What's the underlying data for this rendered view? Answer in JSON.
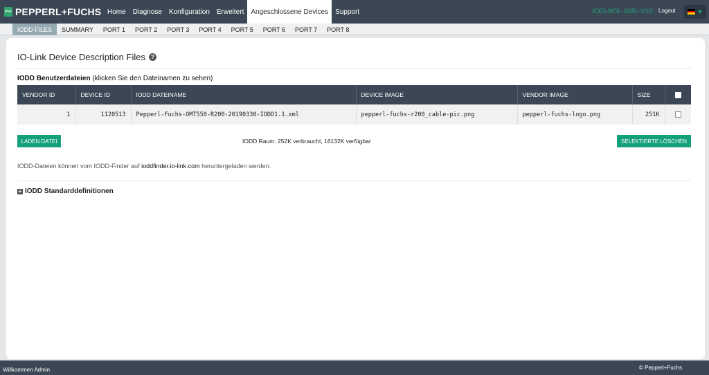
{
  "brand": {
    "mark": "P+F",
    "name": "PEPPERL+FUCHS"
  },
  "nav": {
    "items": [
      {
        "label": "Home"
      },
      {
        "label": "Diagnose"
      },
      {
        "label": "Konfiguration"
      },
      {
        "label": "Erweitert"
      },
      {
        "label": "Angeschlossene Devices"
      },
      {
        "label": "Support"
      }
    ],
    "active_index": 4
  },
  "header": {
    "device_name": "ICE3-8IOL-G65L-V1D",
    "logout_label": "Logout",
    "language_flag_icon": "german-flag-icon"
  },
  "subnav": {
    "items": [
      {
        "label": "IODD FILES"
      },
      {
        "label": "SUMMARY"
      },
      {
        "label": "PORT 1"
      },
      {
        "label": "PORT 2"
      },
      {
        "label": "PORT 3"
      },
      {
        "label": "PORT 4"
      },
      {
        "label": "PORT 5"
      },
      {
        "label": "PORT 6"
      },
      {
        "label": "PORT 7"
      },
      {
        "label": "PORT 8"
      }
    ],
    "active_index": 0
  },
  "page": {
    "title": "IO-Link Device Description Files",
    "help_icon": "question-circle-icon",
    "section_bold": "IODD Benutzerdateien",
    "section_note": " (klicken Sie den Dateinamen zu sehen)"
  },
  "table": {
    "headers": [
      "VENDOR ID",
      "DEVICE ID",
      "IODD DATEINAME",
      "DEVICE IMAGE",
      "VENDOR IMAGE",
      "SIZE"
    ],
    "rows": [
      {
        "vendor_id": "1",
        "device_id": "1120513",
        "filename": "Pepperl-Fuchs-OMT550-R200-20190330-IODD1.1.xml",
        "device_image": "pepperl-fuchs-r200_cable-pic.png",
        "vendor_image": "pepperl-fuchs-logo.png",
        "size": "251K"
      }
    ]
  },
  "actions": {
    "load_label": "LADEN DATEI",
    "space_info": "IODD Raum: 252K verbraucht, 16132K verfügbar",
    "delete_label": "SELEKTIERTE LÖSCHEN"
  },
  "note": {
    "before": "IODD-Dateien können vom IODD-Finder auf ",
    "link": "ioddfinder.io-link.com",
    "after": " heruntergeladen werden."
  },
  "standard_defs": {
    "label": "IODD Standarddefinitionen",
    "icon": "plus-box-icon"
  },
  "footer": {
    "welcome": "Willkommen Admin",
    "copyright": "© Pepperl+Fuchs"
  },
  "colors": {
    "header_bg": "#3b4754",
    "accent_green": "#14a07a",
    "active_tab": "#96aab4"
  }
}
